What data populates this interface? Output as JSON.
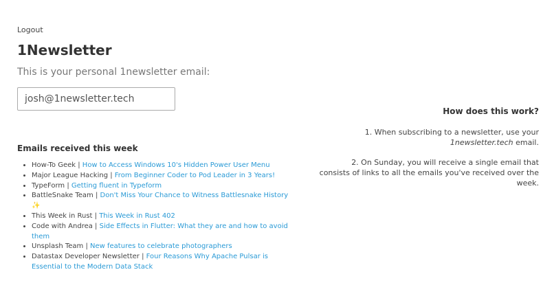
{
  "header": {
    "logout_label": "Logout"
  },
  "page": {
    "title": "1Newsletter",
    "intro": "This is your personal 1newsletter email:",
    "email_value": "josh@1newsletter.tech"
  },
  "emails": {
    "heading": "Emails received this week",
    "items": [
      {
        "sender": "How-To Geek",
        "subject": "How to Access Windows 10's Hidden Power User Menu"
      },
      {
        "sender": "Major League Hacking",
        "subject": "From Beginner Coder to Pod Leader in 3 Years!"
      },
      {
        "sender": "TypeForm",
        "subject": "Getting fluent in Typeform"
      },
      {
        "sender": "BattleSnake Team",
        "subject": "Don't Miss Your Chance to Witness Battlesnake History",
        "emoji": "✨"
      },
      {
        "sender": "This Week in Rust",
        "subject": "This Week in Rust 402"
      },
      {
        "sender": "Code with Andrea",
        "subject": "Side Effects in Flutter: What they are and how to avoid them"
      },
      {
        "sender": "Unsplash Team",
        "subject": "New features to celebrate photographers"
      },
      {
        "sender": "Datastax Developer Newsletter",
        "subject": "Four Reasons Why Apache Pulsar is Essential to the Modern Data Stack"
      }
    ],
    "separator": " | "
  },
  "how": {
    "heading": "How does this work?",
    "step1_prefix": "1. When subscribing to a newsletter, use your",
    "step1_email": "1newsletter.tech",
    "step1_suffix": " email.",
    "step2": "2. On Sunday, you will receive a single email that consists of links to all the emails you've received over the week."
  },
  "colors": {
    "link": "#2a9ad6",
    "text": "#333333",
    "muted": "#777777"
  }
}
